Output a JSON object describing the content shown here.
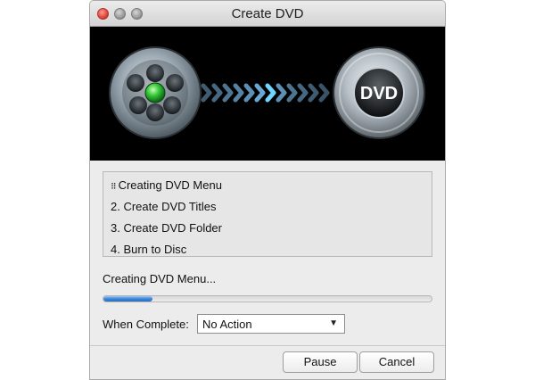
{
  "window": {
    "title": "Create DVD"
  },
  "banner": {
    "disc_label": "DVD",
    "reel_icon": "film-reel-icon",
    "arrows_icon": "chevron-arrows-icon"
  },
  "steps": {
    "items": [
      {
        "label": "Creating DVD Menu",
        "bullet": "⠿"
      },
      {
        "label": "2. Create DVD Titles"
      },
      {
        "label": "3. Create DVD Folder"
      },
      {
        "label": "4. Burn to Disc"
      }
    ]
  },
  "status": {
    "text": "Creating DVD Menu...",
    "progress": 0.15
  },
  "complete": {
    "label": "When Complete:",
    "selected": "No Action",
    "arrow": "▼"
  },
  "buttons": {
    "pause": "Pause",
    "cancel": "Cancel"
  },
  "colors": {
    "progress_fill": "#3a86d8",
    "close_button": "#e0443a",
    "reel_center": "#35c93a",
    "arrow_highlight": "#6fd4ff"
  }
}
